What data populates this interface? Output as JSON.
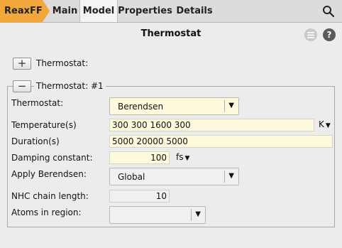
{
  "tabs": {
    "app": "ReaxFF",
    "items": [
      "Main",
      "Model",
      "Properties",
      "Details"
    ],
    "active": "Model"
  },
  "header": {
    "title": "Thermostat",
    "help": "?"
  },
  "collapsed": {
    "label": "Thermostat:",
    "toggle": "+"
  },
  "group": {
    "toggle": "−",
    "label": "Thermostat: #1",
    "thermostat": {
      "label": "Thermostat:",
      "value": "Berendsen"
    },
    "temperature": {
      "label": "Temperature(s)",
      "value": "300 300 1600 300",
      "unit": "K"
    },
    "duration": {
      "label": "Duration(s)",
      "value": "5000 20000 5000"
    },
    "damping": {
      "label": "Damping constant:",
      "value": "100",
      "unit": "fs"
    },
    "apply": {
      "label": "Apply Berendsen:",
      "value": "Global"
    },
    "nhc": {
      "label": "NHC chain length:",
      "value": "10"
    },
    "atoms": {
      "label": "Atoms in region:",
      "value": ""
    }
  },
  "colors": {
    "app_tab": "#f2a73b",
    "input_bg": "#fffadd"
  },
  "icons": [
    "search-icon",
    "menu-icon",
    "help-icon",
    "dropdown-arrow-icon"
  ]
}
